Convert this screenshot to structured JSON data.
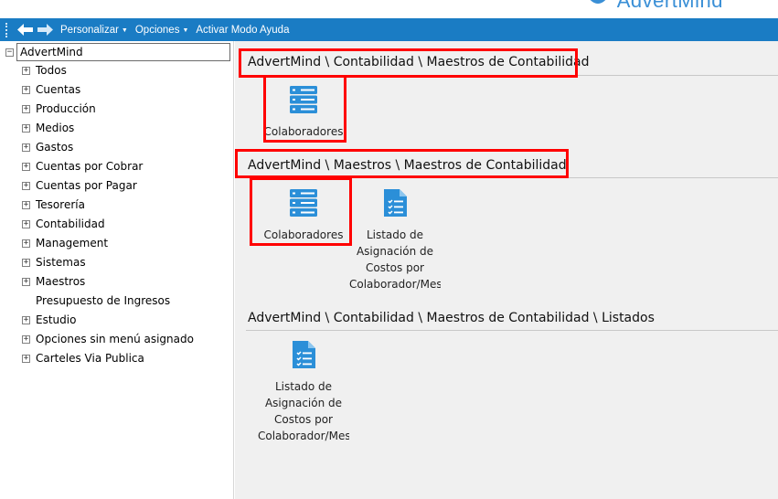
{
  "brand": {
    "name": "AdvertMind"
  },
  "toolbar": {
    "items": [
      {
        "label": "Personalizar",
        "dropdown": true
      },
      {
        "label": "Opciones",
        "dropdown": true
      },
      {
        "label": "Activar Modo Ayuda",
        "dropdown": false
      }
    ]
  },
  "tree": {
    "root": "AdvertMind",
    "items": [
      "Todos",
      "Cuentas",
      "Producción",
      "Medios",
      "Gastos",
      "Cuentas por Cobrar",
      "Cuentas por Pagar",
      "Tesorería",
      "Contabilidad",
      "Management",
      "Sistemas",
      "Maestros",
      "Presupuesto de Ingresos",
      "Estudio",
      "Opciones sin menú asignado",
      "Carteles Via Publica"
    ]
  },
  "sections": [
    {
      "title": "AdvertMind \\ Contabilidad \\ Maestros de Contabilidad",
      "tiles": [
        {
          "label": "Colaboradores",
          "icon": "server-list-icon"
        }
      ]
    },
    {
      "title": "AdvertMind \\ Maestros \\ Maestros de Contabilidad",
      "tiles": [
        {
          "label": "Colaboradores",
          "icon": "server-list-icon"
        },
        {
          "label": "Listado de Asignación de Costos por Colaborador/Mes",
          "icon": "document-checklist-icon"
        }
      ]
    },
    {
      "title": "AdvertMind \\ Contabilidad \\ Maestros de Contabilidad \\ Listados",
      "tiles": [
        {
          "label": "Listado de Asignación de Costos por Colaborador/Mes",
          "icon": "document-checklist-icon"
        }
      ]
    }
  ],
  "colors": {
    "toolbar": "#1a7cc4",
    "accent_icon": "#2b8fd8",
    "highlight": "#ff0000"
  }
}
